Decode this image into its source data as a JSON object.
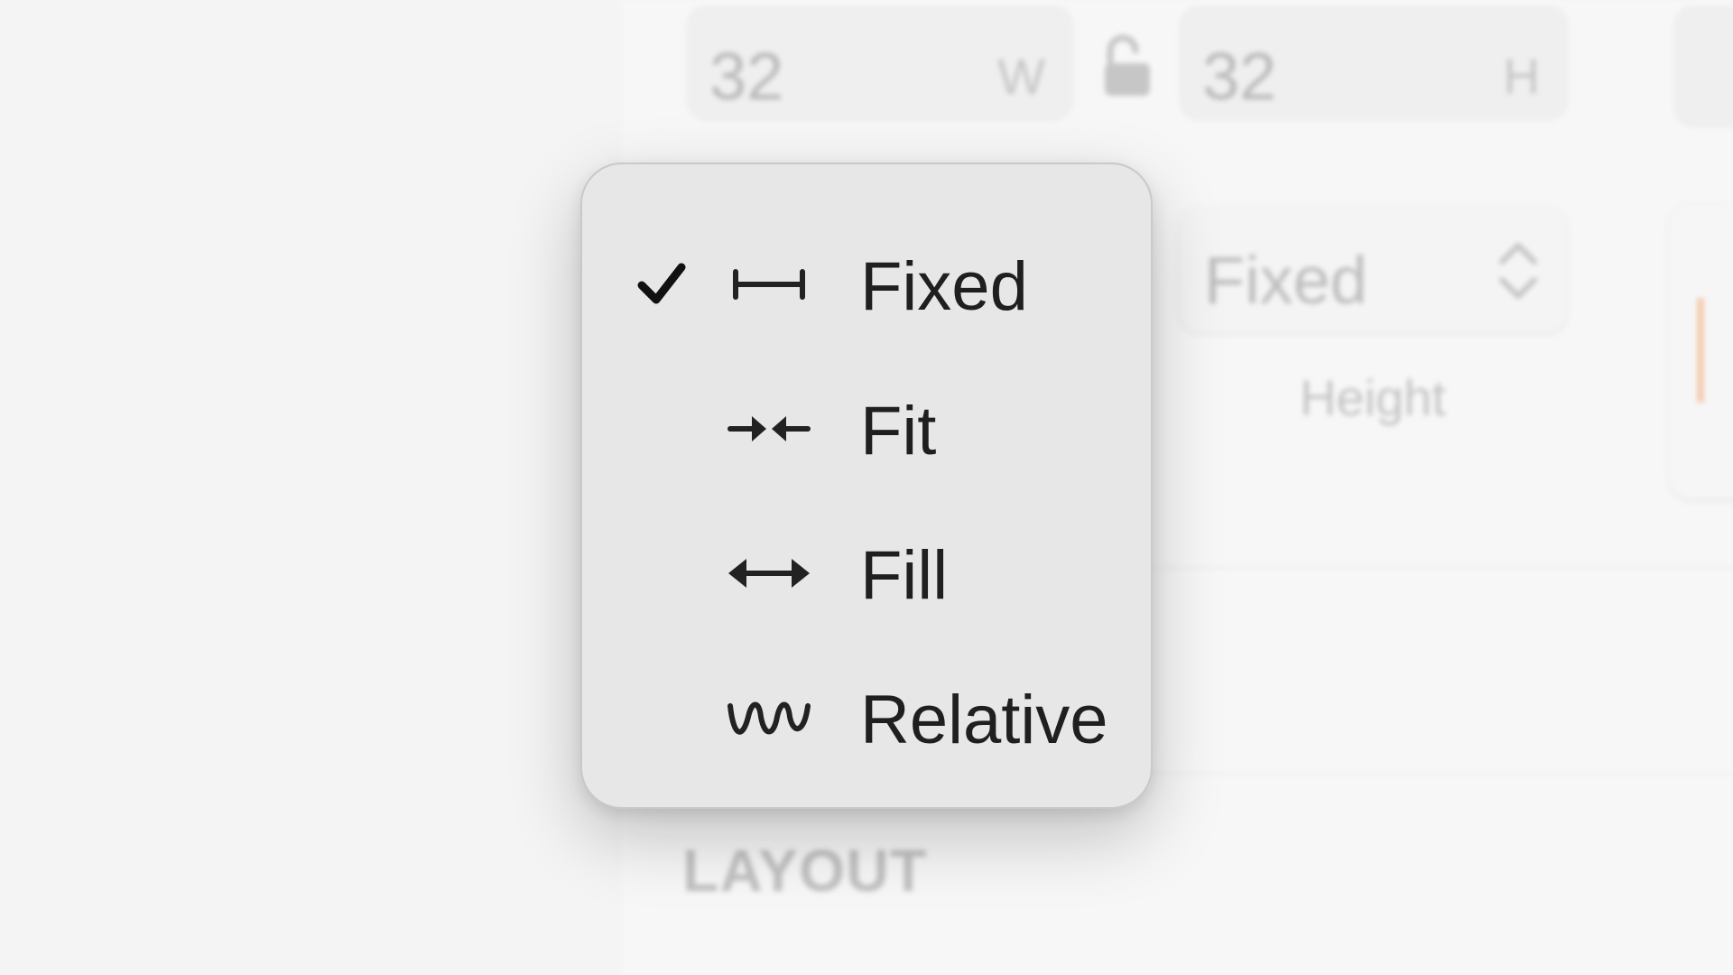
{
  "dimensions": {
    "width_value": "32",
    "width_unit": "W",
    "height_value": "32",
    "height_unit": "H"
  },
  "height_sizing": {
    "selected_value": "Fixed",
    "label": "Height"
  },
  "section_title": "LAYOUT",
  "menu": {
    "selected": "Fixed",
    "items": [
      {
        "label": "Fixed",
        "icon": "fixed-width-icon",
        "checked": true
      },
      {
        "label": "Fit",
        "icon": "fit-arrows-icon",
        "checked": false
      },
      {
        "label": "Fill",
        "icon": "fill-arrows-icon",
        "checked": false
      },
      {
        "label": "Relative",
        "icon": "relative-wave-icon",
        "checked": false
      }
    ]
  },
  "colors": {
    "menu_background": "#e7e7e7",
    "panel_background": "#f7f7f7",
    "accent_preview": "#f5cbb2",
    "text": "#1f1f1f"
  }
}
